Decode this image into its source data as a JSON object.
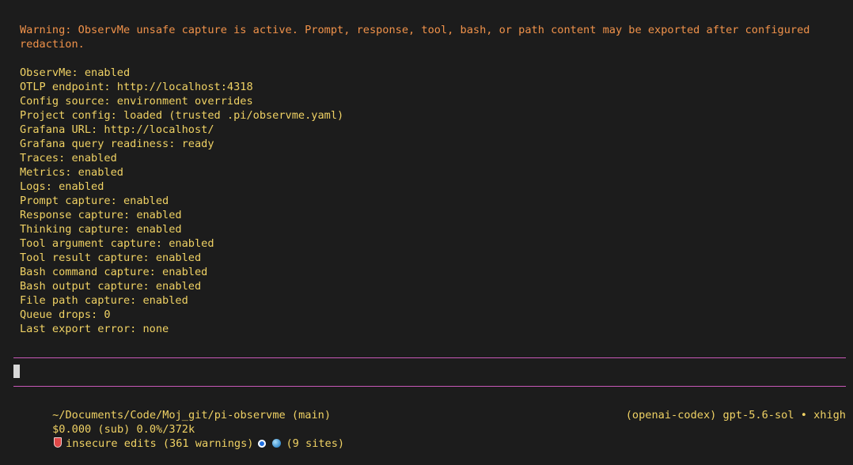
{
  "warning": "Warning: ObservMe unsafe capture is active. Prompt, response, tool, bash, or path content may be exported after configured redaction.",
  "status_lines": [
    "ObservMe: enabled",
    "OTLP endpoint: http://localhost:4318",
    "Config source: environment overrides",
    "Project config: loaded (trusted .pi/observme.yaml)",
    "Grafana URL: http://localhost/",
    "Grafana query readiness: ready",
    "Traces: enabled",
    "Metrics: enabled",
    "Logs: enabled",
    "Prompt capture: enabled",
    "Response capture: enabled",
    "Thinking capture: enabled",
    "Tool argument capture: enabled",
    "Tool result capture: enabled",
    "Bash command capture: enabled",
    "Bash output capture: enabled",
    "File path capture: enabled",
    "Queue drops: 0",
    "Last export error: none"
  ],
  "footer": {
    "path": "~/Documents/Code/Moj_git/pi-observme (main)",
    "usage": "$0.000 (sub) 0.0%/372k",
    "model": "(openai-codex) gpt-5.6-sol • xhigh",
    "edits": "insecure edits (361 warnings)",
    "sites": "(9 sites)"
  },
  "icons": {
    "edits": "shield-icon",
    "mode": "target-icon",
    "sites": "globe-icon"
  },
  "colors": {
    "background": "#1c1c1c",
    "text": "#f0d264",
    "warning": "#f0924a",
    "rule": "#c858b8"
  }
}
